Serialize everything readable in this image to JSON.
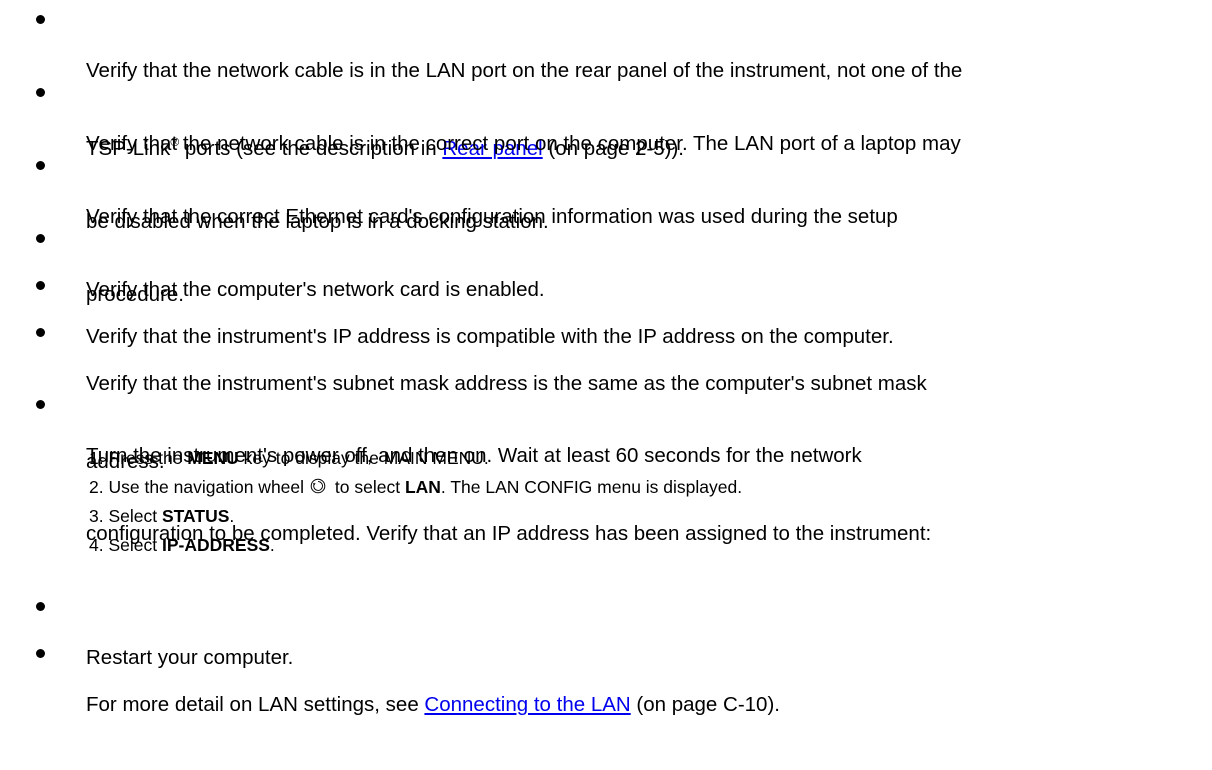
{
  "items": [
    {
      "id": "lan-port",
      "line1_pre": "Verify that the network cable is in the LAN port on the rear panel of the instrument, not one of the",
      "line2_pre": "TSP-Link",
      "line2_sup": "®",
      "line2_mid": " ports (see the description in ",
      "line2_link": "Rear panel",
      "line2_post": " (on page 2-5))."
    },
    {
      "id": "computer-port",
      "lines": [
        "Verify that the network cable is in the correct port on the computer. The LAN port of a laptop may",
        "be disabled when the laptop is in a docking station."
      ]
    },
    {
      "id": "ethernet-card",
      "lines": [
        "Verify that the correct Ethernet card's configuration information was used during the setup",
        "procedure."
      ]
    },
    {
      "id": "network-card-enabled",
      "lines": [
        "Verify that the computer's network card is enabled."
      ]
    },
    {
      "id": "ip-compatible",
      "lines": [
        "Verify that the instrument's IP address is compatible with the IP address on the computer."
      ]
    },
    {
      "id": "subnet-mask",
      "lines": [
        "Verify that the instrument's subnet mask address is the same as the computer's subnet mask",
        "address."
      ]
    },
    {
      "id": "power-cycle",
      "lines": [
        "Turn the instrument's power off, and then on. Wait at least 60 seconds for the network",
        "configuration to be completed. Verify that an IP address has been assigned to the instrument:"
      ]
    },
    {
      "id": "restart",
      "lines": [
        "Restart your computer."
      ]
    },
    {
      "id": "more-detail",
      "pre": "For more detail on LAN settings, see ",
      "link": "Connecting to the LAN",
      "post": " (on page C-10)."
    }
  ],
  "steps": [
    {
      "num": "1.",
      "pre": "Press the ",
      "bold": "MENU",
      "post": " key to display the MAIN MENU."
    },
    {
      "num": "2.",
      "pre": "Use the navigation wheel",
      "icon": "navigation-wheel-icon",
      "mid": " to select ",
      "bold": "LAN",
      "post": ". The LAN CONFIG menu is displayed."
    },
    {
      "num": "3.",
      "pre": "Select ",
      "bold": "STATUS",
      "post": "."
    },
    {
      "num": "4.",
      "pre": "Select ",
      "bold": "IP-ADDRESS",
      "post": "."
    }
  ],
  "colors": {
    "text": "#000000",
    "link": "#0000ee",
    "background": "#ffffff"
  }
}
